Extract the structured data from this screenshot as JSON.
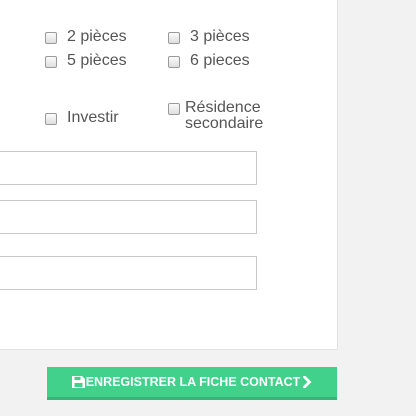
{
  "form": {
    "rooms_options": [
      {
        "label": "2 pièces",
        "checked": false
      },
      {
        "label": "3 pièces",
        "checked": false
      },
      {
        "label": "5 pièces",
        "checked": false
      },
      {
        "label": "6 pieces",
        "checked": false
      }
    ],
    "purpose_options": [
      {
        "label": "Investir",
        "checked": false
      },
      {
        "label_line1": "Résidence",
        "label_line2": "secondaire",
        "checked": false
      }
    ],
    "fields": [
      {
        "value": "",
        "placeholder": ""
      },
      {
        "value": "",
        "placeholder": ""
      },
      {
        "value": "",
        "placeholder": ""
      }
    ]
  },
  "actions": {
    "save_label": "ENREGISTRER LA FICHE CONTACT",
    "save_icon": "floppy-disk-icon",
    "arrow_icon": "chevron-right-icon",
    "accent_color": "#41d18a"
  }
}
